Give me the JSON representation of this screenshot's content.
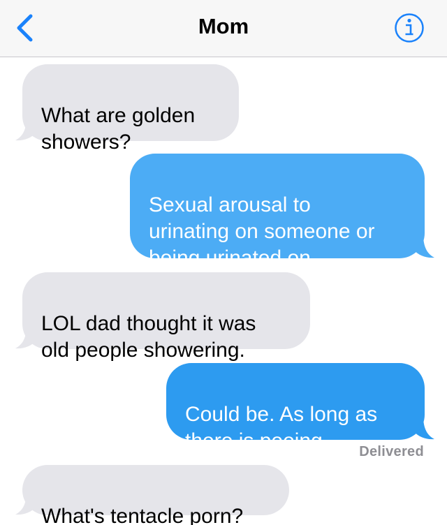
{
  "header": {
    "contact_name": "Mom",
    "back_icon": "chevron-left-icon",
    "info_icon": "info-circle-icon",
    "accent_color": "#1a82fb"
  },
  "messages": [
    {
      "direction": "incoming",
      "text": "What are golden\nshowers?"
    },
    {
      "direction": "outgoing",
      "text": "Sexual arousal to\nurinating on someone or\nbeing urinated on."
    },
    {
      "direction": "incoming",
      "text": "LOL dad thought it was\nold people showering."
    },
    {
      "direction": "outgoing",
      "text": "Could be. As long as\nthere is peeing."
    },
    {
      "direction": "incoming",
      "text": "What's tentacle porn?"
    }
  ],
  "status": {
    "delivered_label": "Delivered"
  },
  "colors": {
    "incoming_bubble": "#e5e5ea",
    "outgoing_bubble": "#2d9bf0",
    "status_text": "#8e8e93"
  }
}
